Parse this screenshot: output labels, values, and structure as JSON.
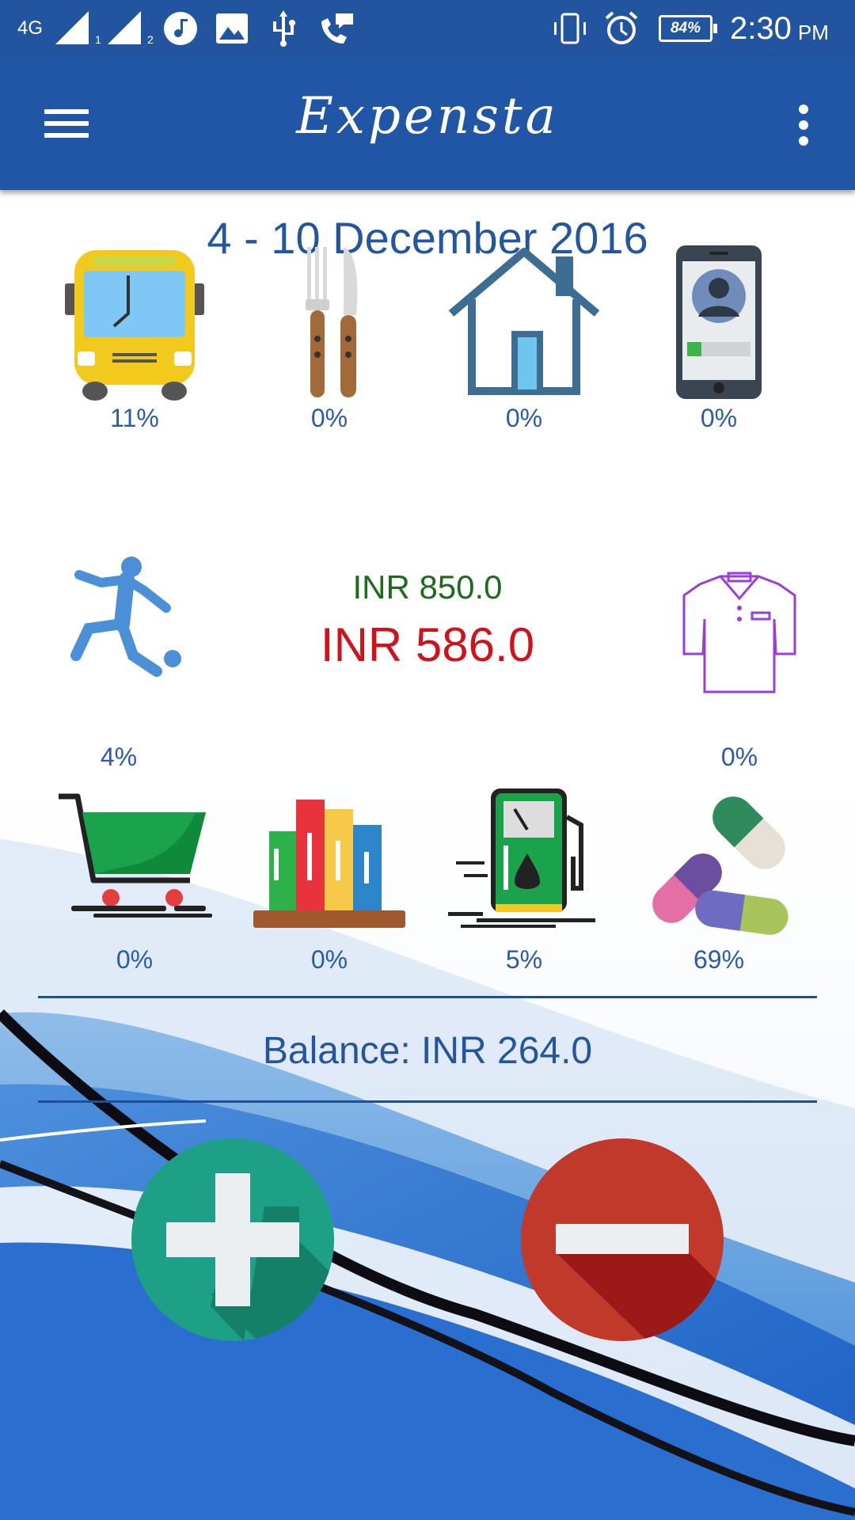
{
  "status_bar": {
    "network": "4G",
    "sim1": "1",
    "sim2": "2",
    "battery": "84%",
    "time": "2:30",
    "ampm": "PM"
  },
  "app_bar": {
    "title": "Expensta"
  },
  "period": "4 - 10 December 2016",
  "categories": [
    {
      "icon": "bus-icon",
      "percent": "11%"
    },
    {
      "icon": "fork-knife-icon",
      "percent": "0%"
    },
    {
      "icon": "house-icon",
      "percent": "0%"
    },
    {
      "icon": "phone-icon",
      "percent": "0%"
    },
    {
      "icon": "soccer-player-icon",
      "percent": "4%"
    },
    {
      "icon": "shirt-icon",
      "percent": "0%"
    },
    {
      "icon": "shopping-cart-icon",
      "percent": "0%"
    },
    {
      "icon": "books-icon",
      "percent": "0%"
    },
    {
      "icon": "fuel-pump-icon",
      "percent": "5%"
    },
    {
      "icon": "pills-icon",
      "percent": "69%"
    }
  ],
  "summary": {
    "budget": "INR 850.0",
    "spent": "INR 586.0"
  },
  "balance": "Balance: INR 264.0",
  "actions": {
    "add_icon": "plus-icon",
    "remove_icon": "minus-icon"
  },
  "colors": {
    "app_bar": "#2156a6",
    "status_bar": "#23549f",
    "text_blue": "#2b5ba8",
    "budget_green": "#1d6b1d",
    "spent_red": "#d3111a",
    "add_button": "#1da085",
    "remove_button": "#c0392b"
  }
}
